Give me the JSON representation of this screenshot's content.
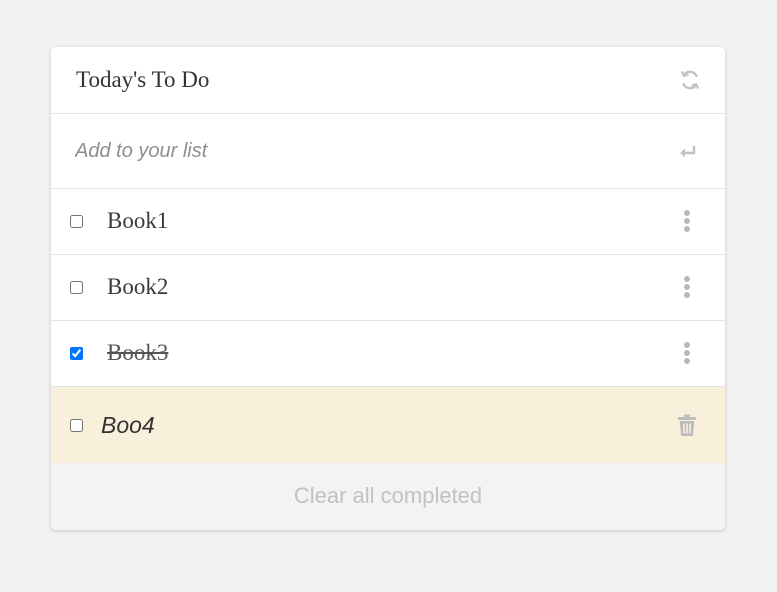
{
  "header": {
    "title": "Today's To Do",
    "refresh_icon": "refresh-icon"
  },
  "add": {
    "placeholder": "Add to your list",
    "value": "",
    "enter_icon": "enter-icon"
  },
  "items": [
    {
      "label": "Book1",
      "checked": false
    },
    {
      "label": "Book2",
      "checked": false
    },
    {
      "label": "Book3",
      "checked": true
    }
  ],
  "editing_item": {
    "value": "Boo4",
    "checked": false,
    "delete_icon": "trash-icon"
  },
  "footer": {
    "clear_label": "Clear all completed"
  },
  "colors": {
    "background": "#f2f2f2",
    "card": "#ffffff",
    "editing_row": "#f9f0dc",
    "footer": "#f3f3f3",
    "icon_gray": "#b8b8b8",
    "checkbox_accent": "#1a73e8"
  }
}
